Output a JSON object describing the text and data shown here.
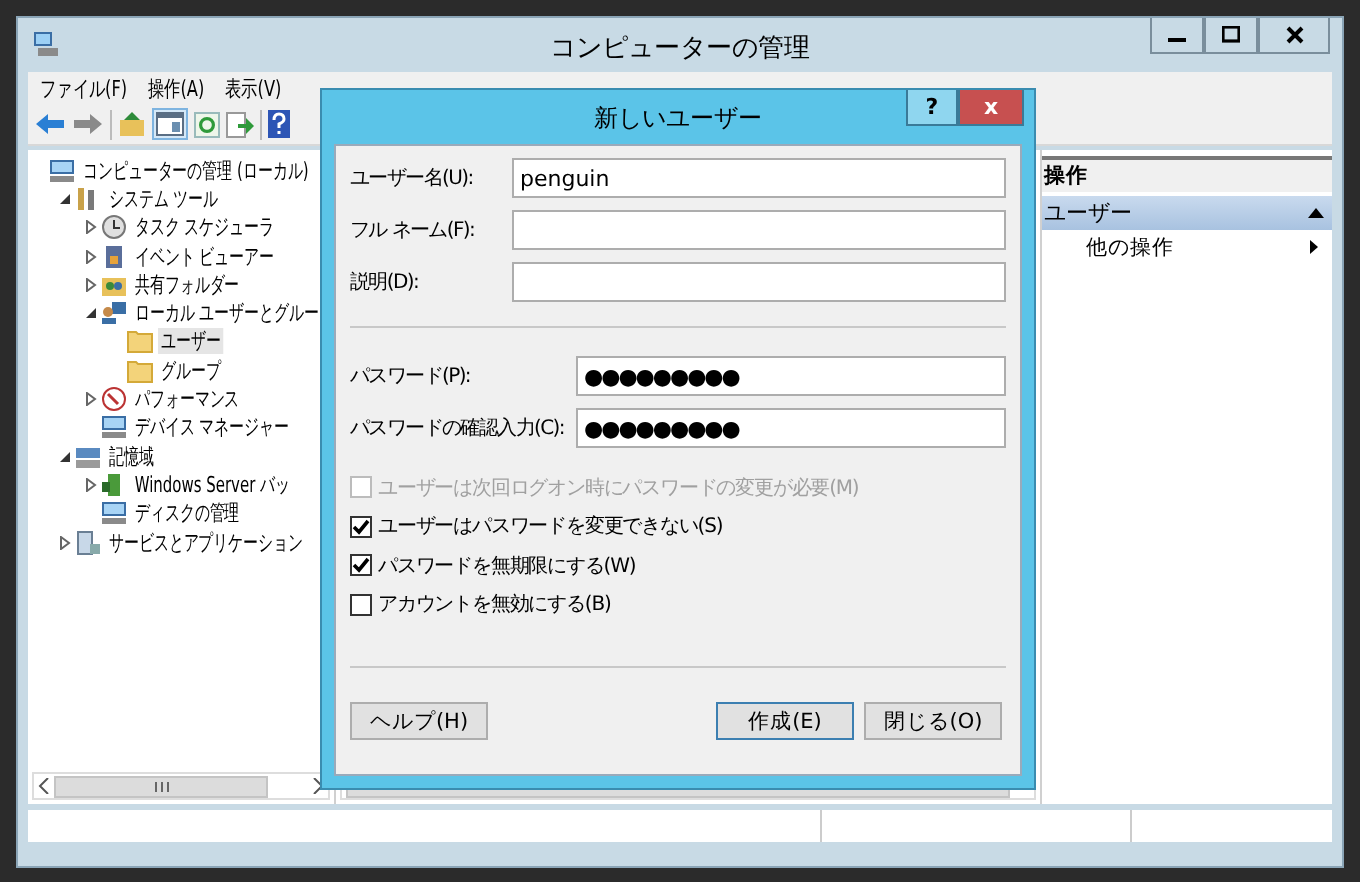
{
  "window": {
    "title": "コンピューターの管理"
  },
  "menu": [
    "ファイル(F)",
    "操作(A)",
    "表示(V)"
  ],
  "tree": [
    {
      "label": "コンピューターの管理 (ローカル)",
      "children": [
        {
          "label": "システム ツール",
          "expanded": true,
          "children": [
            {
              "label": "タスク スケジューラ",
              "expanded": false
            },
            {
              "label": "イベント ビューアー",
              "expanded": false
            },
            {
              "label": "共有フォルダー",
              "expanded": false
            },
            {
              "label": "ローカル ユーザーとグルー",
              "expanded": true,
              "children": [
                {
                  "label": "ユーザー",
                  "selected": true
                },
                {
                  "label": "グループ",
                  "selected": false
                }
              ]
            },
            {
              "label": "パフォーマンス",
              "expanded": false
            },
            {
              "label": "デバイス マネージャー"
            }
          ]
        },
        {
          "label": "記憶域",
          "expanded": true,
          "children": [
            {
              "label": "Windows Server バッ",
              "expanded": false
            },
            {
              "label": "ディスクの管理"
            }
          ]
        },
        {
          "label": "サービスとアプリケーション",
          "expanded": false
        }
      ]
    }
  ],
  "actions": {
    "header": "操作",
    "section": {
      "label": "ユーザー",
      "expanded": true
    },
    "items": [
      "他の操作"
    ]
  },
  "dialog": {
    "title": "新しいユーザー",
    "help_button": "?",
    "close_button": "x",
    "fields": [
      {
        "label": "ユーザー名(U):",
        "value": "penguin"
      },
      {
        "label": "フル ネーム(F):"
      },
      {
        "label": "説明(D):"
      }
    ],
    "password_fields": [
      {
        "label": "パスワード(P):",
        "value": "●●●●●●●●●"
      },
      {
        "label": "パスワードの確認入力(C):",
        "value": "●●●●●●●●●"
      }
    ],
    "options": [
      {
        "label": "ユーザーは次回ログオン時にパスワードの変更が必要(M)",
        "checked": false,
        "disabled": true
      },
      {
        "label": "ユーザーはパスワードを変更できない(S)",
        "checked": true,
        "disabled": false
      },
      {
        "label": "パスワードを無期限にする(W)",
        "checked": true,
        "disabled": false
      },
      {
        "label": "アカウントを無効にする(B)",
        "checked": false,
        "disabled": false
      }
    ],
    "buttons": [
      {
        "label": "ヘルプ(H)",
        "default": false
      },
      {
        "label": "作成(E)",
        "default": true
      },
      {
        "label": "閉じる(O)",
        "default": false
      }
    ]
  }
}
